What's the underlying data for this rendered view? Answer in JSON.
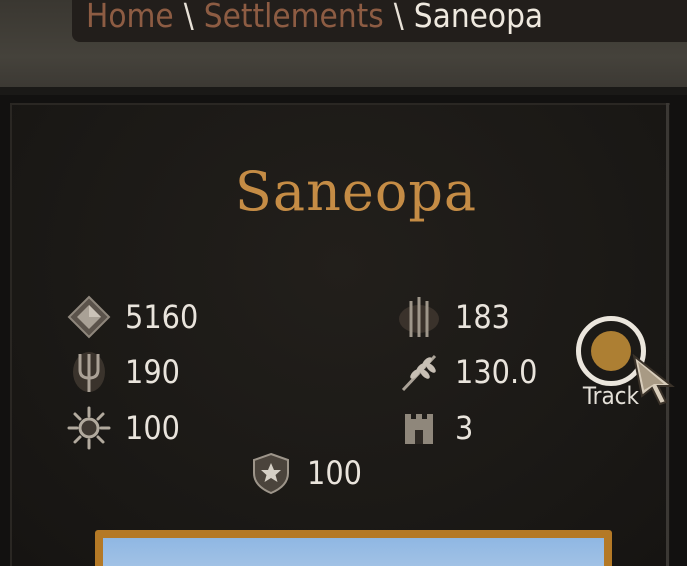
{
  "breadcrumb": {
    "items": [
      "Home",
      "Settlements"
    ],
    "separator": "\\",
    "current": "Saneopa"
  },
  "settlement": {
    "name": "Saneopa"
  },
  "stats": {
    "prosperity": "5160",
    "militia": "190",
    "loyalty": "100",
    "security": "100",
    "garrison": "183",
    "food": "130.0",
    "walls": "3"
  },
  "icons": {
    "prosperity": "diamond-icon",
    "militia": "pitchfork-icon",
    "loyalty": "sun-icon",
    "security": "shield-star-icon",
    "garrison": "spears-icon",
    "food": "wheat-icon",
    "walls": "tower-icon"
  },
  "track": {
    "label": "Track"
  },
  "colors": {
    "title": "#c58c45",
    "breadcrumb_link": "#8d5c43",
    "track_fill": "#ad7f33",
    "text": "#e9e4dc"
  }
}
